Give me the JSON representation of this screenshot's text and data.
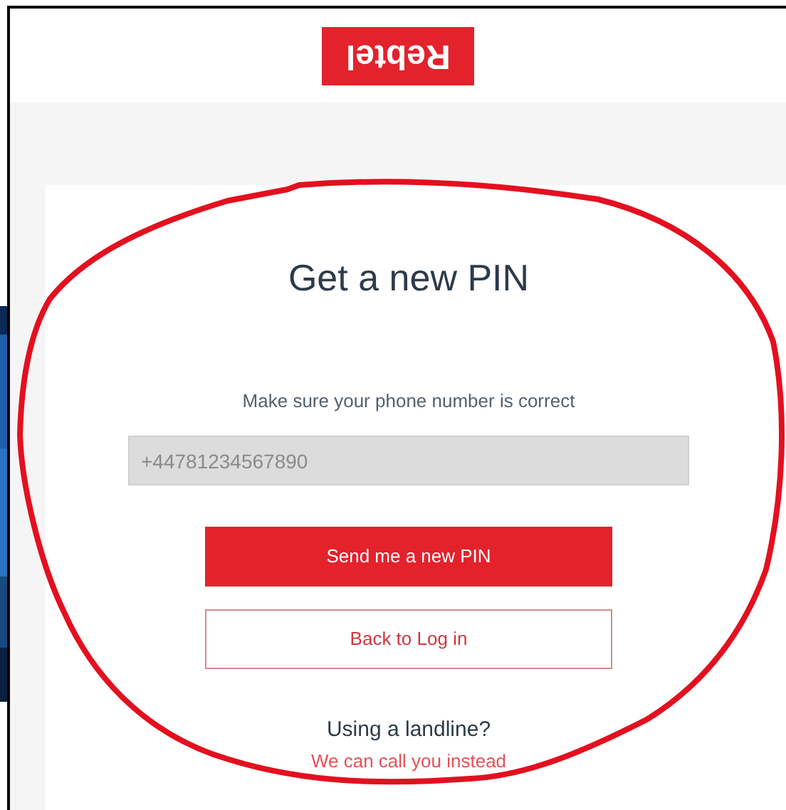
{
  "logo": {
    "text": "Rebtel"
  },
  "title": "Get a new PIN",
  "instruction": "Make sure your phone number is correct",
  "phone_field": {
    "value": "+44781234567890",
    "disabled": true
  },
  "buttons": [
    {
      "label": "Send me a new PIN",
      "kind": "primary"
    },
    {
      "label": "Back to Log in",
      "kind": "secondary"
    }
  ],
  "landline": {
    "question": "Using a landline?",
    "link": "We can call you instead"
  }
}
